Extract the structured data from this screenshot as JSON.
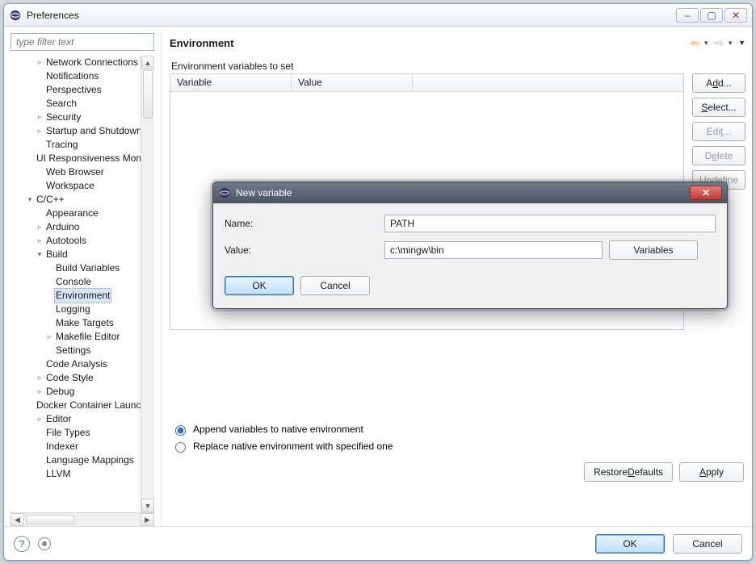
{
  "window": {
    "title": "Preferences",
    "sys": {
      "min": "–",
      "max": "▢",
      "close": "✕"
    }
  },
  "filter_placeholder": "type filter text",
  "tree": [
    {
      "lbl": "Network Connections",
      "ind": 1,
      "arr": "▹"
    },
    {
      "lbl": "Notifications",
      "ind": 1,
      "arr": ""
    },
    {
      "lbl": "Perspectives",
      "ind": 1,
      "arr": ""
    },
    {
      "lbl": "Search",
      "ind": 1,
      "arr": ""
    },
    {
      "lbl": "Security",
      "ind": 1,
      "arr": "▹"
    },
    {
      "lbl": "Startup and Shutdown",
      "ind": 1,
      "arr": "▹"
    },
    {
      "lbl": "Tracing",
      "ind": 1,
      "arr": ""
    },
    {
      "lbl": "UI Responsiveness Monitoring",
      "ind": 1,
      "arr": ""
    },
    {
      "lbl": "Web Browser",
      "ind": 1,
      "arr": ""
    },
    {
      "lbl": "Workspace",
      "ind": 1,
      "arr": ""
    },
    {
      "lbl": "C/C++",
      "ind": 0,
      "arr": "▾"
    },
    {
      "lbl": "Appearance",
      "ind": 1,
      "arr": ""
    },
    {
      "lbl": "Arduino",
      "ind": 1,
      "arr": "▹"
    },
    {
      "lbl": "Autotools",
      "ind": 1,
      "arr": "▹"
    },
    {
      "lbl": "Build",
      "ind": 1,
      "arr": "▾"
    },
    {
      "lbl": "Build Variables",
      "ind": 2,
      "arr": ""
    },
    {
      "lbl": "Console",
      "ind": 2,
      "arr": ""
    },
    {
      "lbl": "Environment",
      "ind": 2,
      "arr": "",
      "sel": true
    },
    {
      "lbl": "Logging",
      "ind": 2,
      "arr": ""
    },
    {
      "lbl": "Make Targets",
      "ind": 2,
      "arr": ""
    },
    {
      "lbl": "Makefile Editor",
      "ind": 2,
      "arr": "▹"
    },
    {
      "lbl": "Settings",
      "ind": 2,
      "arr": ""
    },
    {
      "lbl": "Code Analysis",
      "ind": 1,
      "arr": ""
    },
    {
      "lbl": "Code Style",
      "ind": 1,
      "arr": "▹"
    },
    {
      "lbl": "Debug",
      "ind": 1,
      "arr": "▹"
    },
    {
      "lbl": "Docker Container Launcher",
      "ind": 1,
      "arr": ""
    },
    {
      "lbl": "Editor",
      "ind": 1,
      "arr": "▹"
    },
    {
      "lbl": "File Types",
      "ind": 1,
      "arr": ""
    },
    {
      "lbl": "Indexer",
      "ind": 1,
      "arr": ""
    },
    {
      "lbl": "Language Mappings",
      "ind": 1,
      "arr": ""
    },
    {
      "lbl": "LLVM",
      "ind": 1,
      "arr": ""
    }
  ],
  "page": {
    "heading": "Environment",
    "section": "Environment variables to set",
    "cols": {
      "variable": "Variable",
      "value": "Value"
    },
    "buttons": {
      "add": "Add...",
      "select": "Select...",
      "edit": "Edit...",
      "delete": "Delete",
      "undefine": "Undefine"
    },
    "radios": {
      "append": "Append variables to native environment",
      "replace": "Replace native environment with specified one"
    },
    "restore": "Restore Defaults",
    "restore_mn": "D",
    "apply": "Apply",
    "apply_mn": "A"
  },
  "footer": {
    "ok": "OK",
    "cancel": "Cancel"
  },
  "dialog": {
    "title": "New variable",
    "name_label": "Name:",
    "name_value": "PATH",
    "value_label": "Value:",
    "value_value": "c:\\mingw\\bin",
    "variables_btn": "Variables",
    "ok": "OK",
    "cancel": "Cancel"
  }
}
